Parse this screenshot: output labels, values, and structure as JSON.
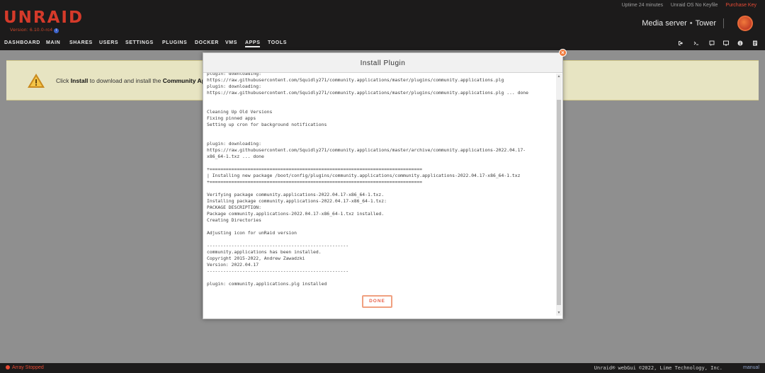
{
  "header": {
    "logo": "UNRAID",
    "logo_sub": "Version: 6.10.0-rc4",
    "status": {
      "uptime": "Uptime 24 minutes",
      "key": "Unraid OS No Keyfile",
      "purchase": "Purchase Key"
    },
    "server_description": "Media server",
    "server_name": "Tower"
  },
  "nav": {
    "items": [
      "DASHBOARD",
      "MAIN",
      "SHARES",
      "USERS",
      "SETTINGS",
      "PLUGINS",
      "DOCKER",
      "VMS",
      "APPS",
      "TOOLS"
    ],
    "active": "APPS",
    "icons": [
      "logout-icon",
      "terminal-icon",
      "feedback-icon",
      "monitor-icon",
      "info-icon",
      "log-icon"
    ]
  },
  "banner": {
    "text_before": "Click ",
    "install_word": "Install",
    "text_middle": " to download and install the ",
    "app_name": "Community Applic"
  },
  "modal": {
    "title": "Install Plugin",
    "done_label": "DONE",
    "log_lines": [
      "plugin: downloading:",
      "https://raw.githubusercontent.com/Squidly271/community.applications/master/plugins/community.applications.plg",
      "plugin: downloading:",
      "https://raw.githubusercontent.com/Squidly271/community.applications/master/plugins/community.applications.plg ... done",
      "",
      "",
      "Cleaning Up Old Versions",
      "Fixing pinned apps",
      "Setting up cron for background notifications",
      "",
      "",
      "plugin: downloading:",
      "https://raw.githubusercontent.com/Squidly271/community.applications/master/archive/community.applications-2022.04.17-",
      "x86_64-1.txz ... done",
      "",
      "+==============================================================================",
      "| Installing new package /boot/config/plugins/community.applications/community.applications-2022.04.17-x86_64-1.txz",
      "+==============================================================================",
      "",
      "Verifying package community.applications-2022.04.17-x86_64-1.txz.",
      "Installing package community.applications-2022.04.17-x86_64-1.txz:",
      "PACKAGE DESCRIPTION:",
      "Package community.applications-2022.04.17-x86_64-1.txz installed.",
      "Creating Directories",
      "",
      "Adjusting icon for unRaid version",
      "",
      "----------------------------------------------------",
      "community.applications has been installed.",
      "Copyright 2015-2022, Andrew Zawadzki",
      "Version: 2022.04.17",
      "----------------------------------------------------",
      "",
      "plugin: community.applications.plg installed"
    ]
  },
  "footer": {
    "array_status": "Array Stopped",
    "copyright": "Unraid® webGui ©2022, Lime Technology, Inc.",
    "manual": "manual"
  },
  "colors": {
    "accent": "#e84b35",
    "header_bg": "#1c1b1b",
    "banner_bg": "#e7e4c2"
  }
}
